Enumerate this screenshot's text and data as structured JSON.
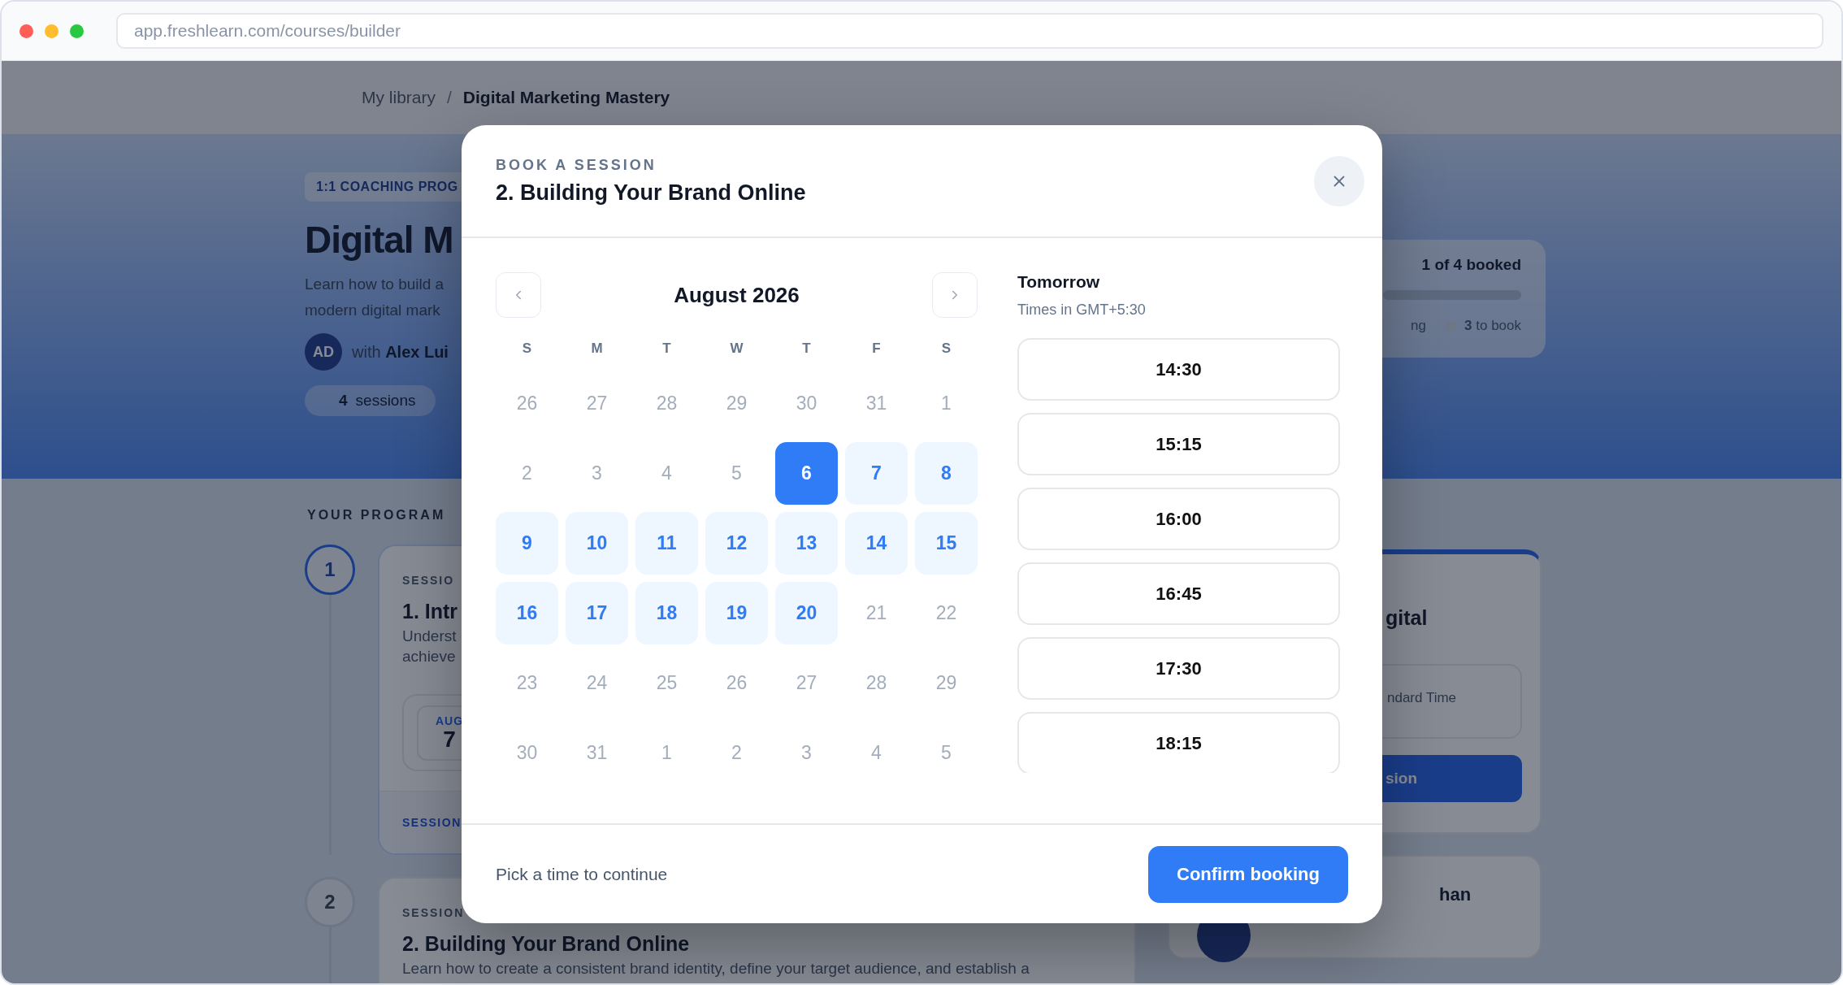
{
  "browser": {
    "url": "app.freshlearn.com/courses/builder"
  },
  "breadcrumb": {
    "separator": "/",
    "items": [
      {
        "label": "My library",
        "current": false
      },
      {
        "label": "Digital Marketing Mastery",
        "current": true
      }
    ]
  },
  "hero": {
    "badge": "1:1 COACHING PROG",
    "title": "Digital M",
    "description": [
      "Learn how to build a",
      "modern digital mark"
    ],
    "coach": {
      "initials": "AD",
      "text": "with **Alex Lui**"
    },
    "sessions": {
      "count": "4",
      "label": "sessions"
    }
  },
  "progress": {
    "summary": "1 of 4 booked",
    "legend_tail": "ng",
    "to_book": {
      "count": "3",
      "label": "to book"
    }
  },
  "program": {
    "heading": "YOUR PROGRAM",
    "sessions": [
      {
        "number": "1",
        "current": true,
        "eyebrow": "SESSIO",
        "title": "1. Intr",
        "description": [
          "Underst",
          "achieve"
        ],
        "date": {
          "month": "AUG",
          "day": "7"
        },
        "footer": "SESSION"
      },
      {
        "number": "2",
        "current": false,
        "eyebrow": "SESSION",
        "title": "2. Building Your Brand Online",
        "description": [
          "Learn how to create a consistent brand identity, define your target audience, and establish a"
        ]
      }
    ]
  },
  "sidebar": {
    "next_card": {
      "title_tail": "gital",
      "timezone_tail": "ndard Time",
      "button_tail": "sion"
    },
    "coach_card": {
      "name_tail": "han"
    }
  },
  "modal": {
    "eyebrow": "BOOK A SESSION",
    "title": "2. Building Your Brand Online",
    "calendar": {
      "month": "August 2026",
      "weekdays": [
        "S",
        "M",
        "T",
        "W",
        "T",
        "F",
        "S"
      ],
      "days": [
        {
          "label": "26",
          "available": false,
          "selected": false
        },
        {
          "label": "27",
          "available": false,
          "selected": false
        },
        {
          "label": "28",
          "available": false,
          "selected": false
        },
        {
          "label": "29",
          "available": false,
          "selected": false
        },
        {
          "label": "30",
          "available": false,
          "selected": false
        },
        {
          "label": "31",
          "available": false,
          "selected": false
        },
        {
          "label": "1",
          "available": false,
          "selected": false
        },
        {
          "label": "2",
          "available": false,
          "selected": false
        },
        {
          "label": "3",
          "available": false,
          "selected": false
        },
        {
          "label": "4",
          "available": false,
          "selected": false
        },
        {
          "label": "5",
          "available": false,
          "selected": false
        },
        {
          "label": "6",
          "available": true,
          "selected": true
        },
        {
          "label": "7",
          "available": true,
          "selected": false
        },
        {
          "label": "8",
          "available": true,
          "selected": false
        },
        {
          "label": "9",
          "available": true,
          "selected": false
        },
        {
          "label": "10",
          "available": true,
          "selected": false
        },
        {
          "label": "11",
          "available": true,
          "selected": false
        },
        {
          "label": "12",
          "available": true,
          "selected": false
        },
        {
          "label": "13",
          "available": true,
          "selected": false
        },
        {
          "label": "14",
          "available": true,
          "selected": false
        },
        {
          "label": "15",
          "available": true,
          "selected": false
        },
        {
          "label": "16",
          "available": true,
          "selected": false
        },
        {
          "label": "17",
          "available": true,
          "selected": false
        },
        {
          "label": "18",
          "available": true,
          "selected": false
        },
        {
          "label": "19",
          "available": true,
          "selected": false
        },
        {
          "label": "20",
          "available": true,
          "selected": false
        },
        {
          "label": "21",
          "available": false,
          "selected": false
        },
        {
          "label": "22",
          "available": false,
          "selected": false
        },
        {
          "label": "23",
          "available": false,
          "selected": false
        },
        {
          "label": "24",
          "available": false,
          "selected": false
        },
        {
          "label": "25",
          "available": false,
          "selected": false
        },
        {
          "label": "26",
          "available": false,
          "selected": false
        },
        {
          "label": "27",
          "available": false,
          "selected": false
        },
        {
          "label": "28",
          "available": false,
          "selected": false
        },
        {
          "label": "29",
          "available": false,
          "selected": false
        },
        {
          "label": "30",
          "available": false,
          "selected": false
        },
        {
          "label": "31",
          "available": false,
          "selected": false
        },
        {
          "label": "1",
          "available": false,
          "selected": false
        },
        {
          "label": "2",
          "available": false,
          "selected": false
        },
        {
          "label": "3",
          "available": false,
          "selected": false
        },
        {
          "label": "4",
          "available": false,
          "selected": false
        },
        {
          "label": "5",
          "available": false,
          "selected": false
        }
      ]
    },
    "times": {
      "heading": "Tomorrow",
      "timezone": "Times in GMT+5:30",
      "slots": [
        {
          "time": "14:30",
          "selected": false
        },
        {
          "time": "15:15",
          "selected": false
        },
        {
          "time": "16:00",
          "selected": false
        },
        {
          "time": "16:45",
          "selected": false
        },
        {
          "time": "17:30",
          "selected": false
        },
        {
          "time": "18:15",
          "selected": false
        }
      ]
    },
    "footer": {
      "hint": "Pick a time to continue",
      "confirm": "Confirm booking"
    }
  }
}
